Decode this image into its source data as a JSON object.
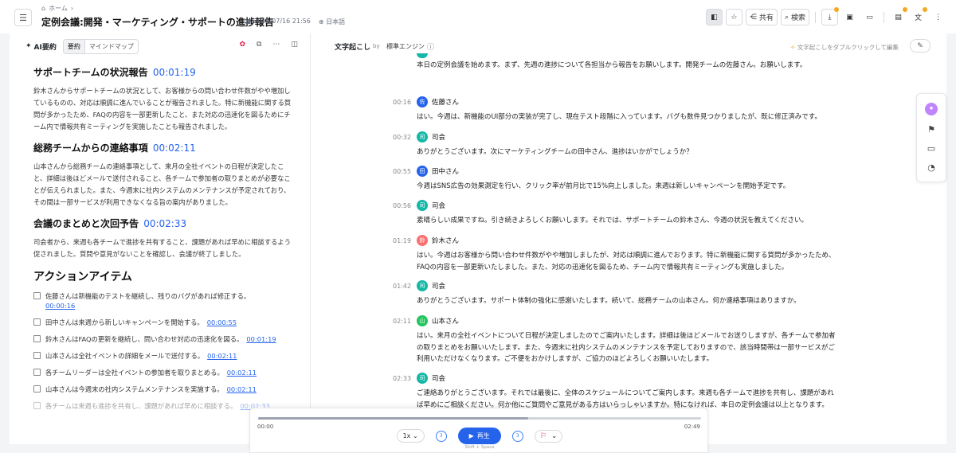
{
  "topbar": {
    "breadcrumb_home": "ホーム",
    "title": "定例会議:開発・マーケティング・サポートの進捗報告",
    "datetime": "2025/07/16 21:56",
    "language": "日本語",
    "share_label": "共有",
    "search_label": "検索"
  },
  "summary_panel": {
    "ai_label": "AI要約",
    "tabs": [
      "要約",
      "マインドマップ"
    ],
    "sections": [
      {
        "heading": "サポートチームの状況報告",
        "ts": "00:01:19",
        "body": "鈴木さんからサポートチームの状況として、お客様からの問い合わせ件数がやや増加しているものの、対応は順調に進んでいることが報告されました。特に新機能に関する質問が多かったため、FAQの内容を一部更新したこと、また対応の迅速化を図るためにチーム内で情報共有ミーティングを実施したことも報告されました。"
      },
      {
        "heading": "総務チームからの連絡事項",
        "ts": "00:02:11",
        "body": "山本さんから総務チームの連絡事項として、来月の全社イベントの日程が決定したこと、詳細は後ほどメールで送付されること、各チームで参加者の取りまとめが必要なことが伝えられました。また、今週末に社内システムのメンテナンスが予定されており、その間は一部サービスが利用できなくなる旨の案内がありました。"
      },
      {
        "heading": "会議のまとめと次回予告",
        "ts": "00:02:33",
        "body": "司会者から、来週も各チームで進捗を共有すること、課題があれば早めに相談するよう促されました。質問や意見がないことを確認し、会議が終了しました。"
      }
    ],
    "actions_heading": "アクションアイテム",
    "actions": [
      {
        "text": "佐藤さんは新機能のテストを継続し、残りのバグがあれば修正する。",
        "ts": "00:00:16"
      },
      {
        "text": "田中さんは来週から新しいキャンペーンを開始する。",
        "ts": "00:00:55"
      },
      {
        "text": "鈴木さんはFAQの更新を継続し、問い合わせ対応の迅速化を図る。",
        "ts": "00:01:19"
      },
      {
        "text": "山本さんは全社イベントの詳細をメールで送付する。",
        "ts": "00:02:11"
      },
      {
        "text": "各チームリーダーは全社イベントの参加者を取りまとめる。",
        "ts": "00:02:11"
      },
      {
        "text": "山本さんは今週末の社内システムメンテナンスを実施する。",
        "ts": "00:02:11"
      },
      {
        "text": "各チームは来週も進捗を共有し、課題があれば早めに相談する。",
        "ts": "00:02:33"
      }
    ]
  },
  "transcript_panel": {
    "title": "文字起こし",
    "by": "by",
    "engine": "標準エンジン",
    "hint": "文字起こしをダブルクリックして編集",
    "segments": [
      {
        "time": "",
        "speaker": "",
        "avatar": "",
        "color": "#14b8a6",
        "text": "本日の定例会議を始めます。まず、先週の進捗について各担当から報告をお願いします。開発チームの佐藤さん。お願いします。"
      },
      {
        "time": "00:16",
        "speaker": "佐藤さん",
        "avatar": "佐",
        "color": "#2563eb",
        "text": "はい。今週は、新機能のUI部分の実装が完了し、現在テスト段階に入っています。バグも数件見つかりましたが、既に修正済みです。"
      },
      {
        "time": "00:32",
        "speaker": "司会",
        "avatar": "司",
        "color": "#14b8a6",
        "text": "ありがとうございます。次にマーケティングチームの田中さん、進捗はいかがでしょうか？"
      },
      {
        "time": "00:55",
        "speaker": "田中さん",
        "avatar": "田",
        "color": "#2563eb",
        "text": "今週はSNS広告の効果測定を行い、クリック率が前月比で15%向上しました。来週は新しいキャンペーンを開始予定です。"
      },
      {
        "time": "00:56",
        "speaker": "司会",
        "avatar": "司",
        "color": "#14b8a6",
        "text": "素晴らしい成果ですね。引き続きよろしくお願いします。それでは、サポートチームの鈴木さん、今週の状況を教えてください。"
      },
      {
        "time": "01:19",
        "speaker": "鈴木さん",
        "avatar": "鈴",
        "color": "#f87171",
        "text": "はい。今週はお客様から問い合わせ件数がやや増加しましたが、対応は順調に進んでおります。特に新機能に関する質問が多かったため、FAQの内容を一部更新いたしました。また、対応の迅速化を図るため、チーム内で情報共有ミーティングも実施しました。"
      },
      {
        "time": "01:42",
        "speaker": "司会",
        "avatar": "司",
        "color": "#14b8a6",
        "text": "ありがとうございます。サポート体制の強化に感謝いたします。続いて、総務チームの山本さん。何か連絡事項はありますか。"
      },
      {
        "time": "02:11",
        "speaker": "山本さん",
        "avatar": "山",
        "color": "#22c55e",
        "text": "はい。来月の全社イベントについて日程が決定しましたのでご案内いたします。詳細は後ほどメールでお送りしますが、各チームで参加者の取りまとめをお願いいたします。また、今週末に社内システムのメンテナンスを予定しておりますので、該当時間帯は一部サービスがご利用いただけなくなります。ご不便をおかけしますが、ご協力のほどよろしくお願いいたします。"
      },
      {
        "time": "02:33",
        "speaker": "司会",
        "avatar": "司",
        "color": "#14b8a6",
        "text": "ご連絡ありがとうございます。それでは最後に、全体のスケジュールについてご案内します。来週も各チームで進捗を共有し、課題があれば早めにご相談ください。何か他にご質問やご意見がある方はいらっしゃいますか。特になければ、本日の定例会議は以上となります。"
      }
    ]
  },
  "player": {
    "current": "00:00",
    "duration": "02:49",
    "progress": 0.61,
    "speed": "1x",
    "skip_back": "3",
    "skip_fwd": "3",
    "play_label": "再生",
    "shortcut": "Shift + Space"
  }
}
